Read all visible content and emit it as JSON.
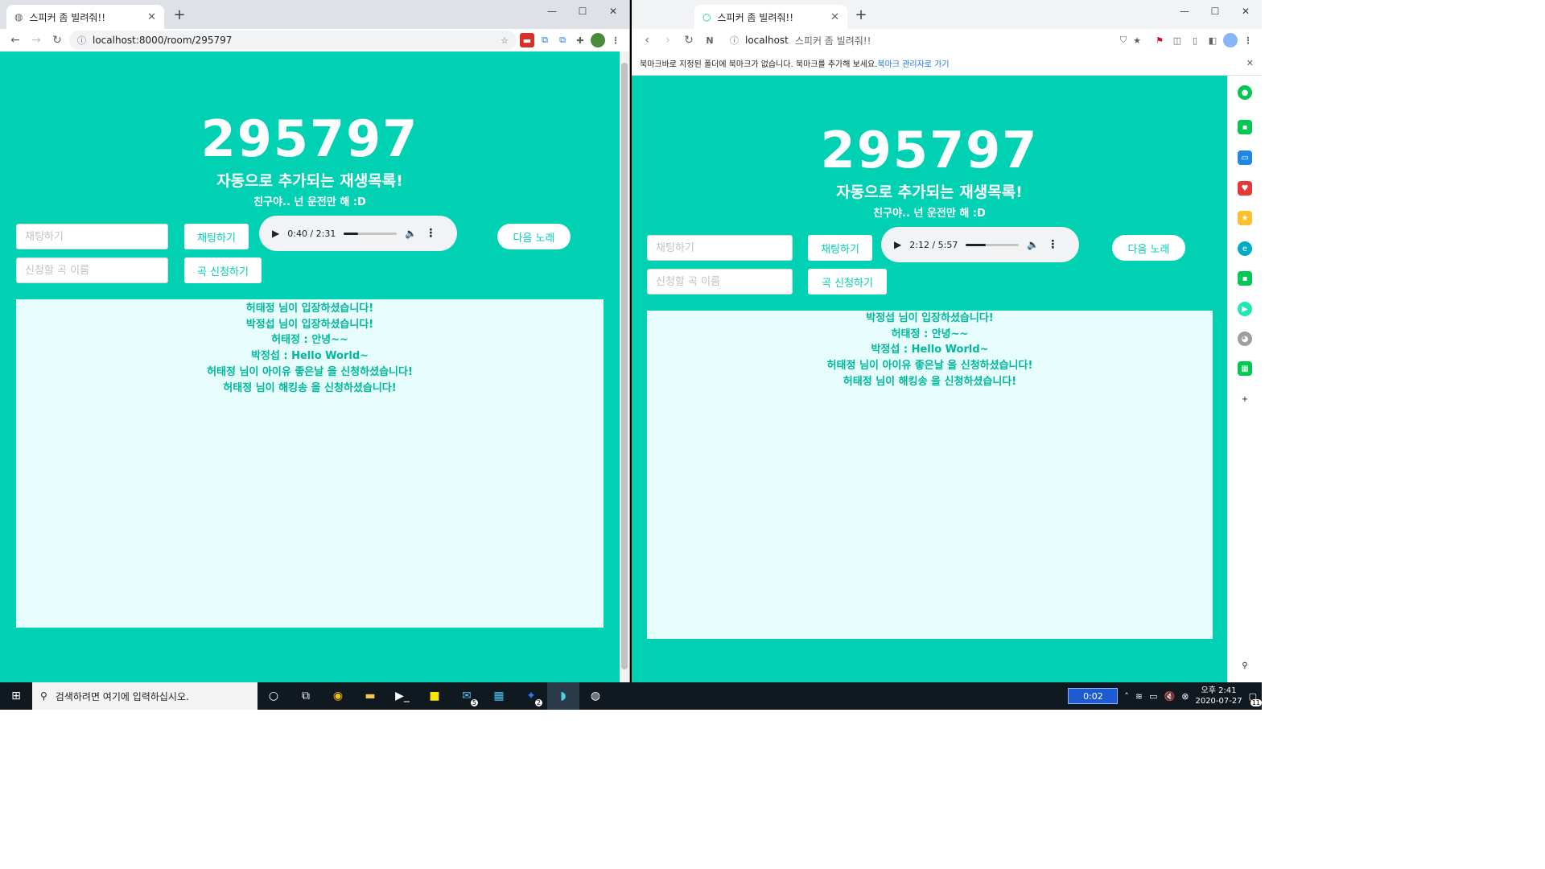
{
  "left_browser": {
    "tab_title": "스피커 좀 빌려줘!!",
    "url": "localhost:8000/room/295797"
  },
  "right_browser": {
    "tab_title": "스피커 좀 빌려줘!!",
    "url_host": "localhost",
    "url_title": "스피커 좀 빌려줘!!",
    "bookmark_notice": "북마크바로 지정된 폴더에 북마크가 없습니다. 북마크를 추가해 보세요.",
    "bookmark_link": "북마크 관리자로 가기"
  },
  "left_page": {
    "room_number": "295797",
    "subtitle": "자동으로 추가되는 재생목록!",
    "subsubtitle": "친구야.. 넌 운전만 해 :D",
    "chat_placeholder": "채팅하기",
    "chat_button": "채팅하기",
    "song_placeholder": "신청할 곡 이름",
    "song_button": "곡 신청하기",
    "next_button": "다음 노래",
    "audio_time": "0:40 / 2:31",
    "audio_progress": 0.27,
    "chat_messages": [
      "허태정 님이 입장하셨습니다!",
      "박정섭 님이 입장하셨습니다!",
      "허태정 : 안녕~~",
      "박정섭 : Hello World~",
      "허태정 님이 아이유 좋은날 을 신청하셨습니다!",
      "허태정 님이 해킹송 을 신청하셨습니다!"
    ]
  },
  "right_page": {
    "room_number": "295797",
    "subtitle": "자동으로 추가되는 재생목록!",
    "subsubtitle": "친구야.. 넌 운전만 해 :D",
    "chat_placeholder": "채팅하기",
    "chat_button": "채팅하기",
    "song_placeholder": "신청할 곡 이름",
    "song_button": "곡 신청하기",
    "next_button": "다음 노래",
    "audio_time": "2:12 / 5:57",
    "audio_progress": 0.37,
    "chat_messages": [
      "박정섭 님이 입장하셨습니다!",
      "허태정 : 안녕~~",
      "박정섭 : Hello World~",
      "허태정 님이 아이유 좋은날 을 신청하셨습니다!",
      "허태정 님이 해킹송 을 신청하셨습니다!"
    ]
  },
  "taskbar": {
    "search_placeholder": "검색하려면 여기에 입력하십시오.",
    "mail_badge": "5",
    "messenger_badge": "2",
    "timer": "0:02",
    "time": "오후 2:41",
    "date": "2020-07-27",
    "notification_count": "11"
  },
  "colors": {
    "primary": "#00d1b2",
    "chat_bg": "#e6fdfb",
    "taskbar": "#101820"
  }
}
